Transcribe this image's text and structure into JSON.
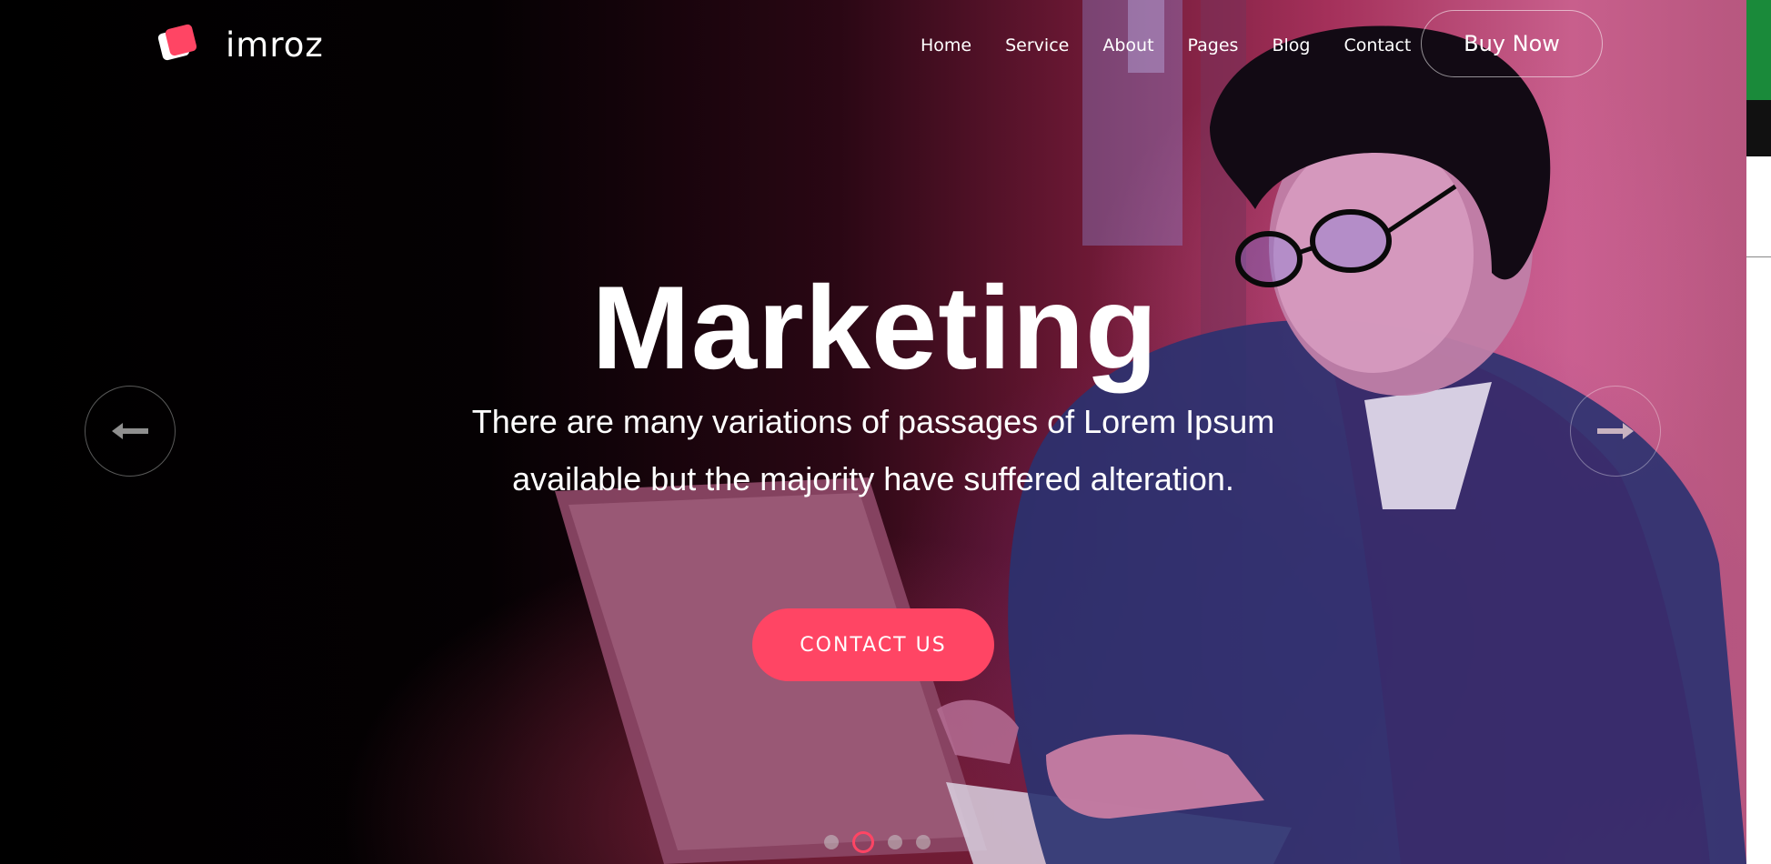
{
  "brand": {
    "name": "imroz",
    "accent_color": "#ff4564"
  },
  "nav": {
    "items": [
      {
        "label": "Home"
      },
      {
        "label": "Service"
      },
      {
        "label": "About"
      },
      {
        "label": "Pages"
      },
      {
        "label": "Blog"
      },
      {
        "label": "Contact"
      }
    ],
    "cta_label": "Buy Now"
  },
  "hero": {
    "title": "Marketing",
    "subtitle_line1": "There are many variations of passages of Lorem Ipsum",
    "subtitle_line2": "available but the majority have suffered alteration.",
    "button_label": "CONTACT US",
    "prev_icon": "arrow-left-icon",
    "next_icon": "arrow-right-icon"
  },
  "slider": {
    "slide_count": 4,
    "active_index": 1
  }
}
